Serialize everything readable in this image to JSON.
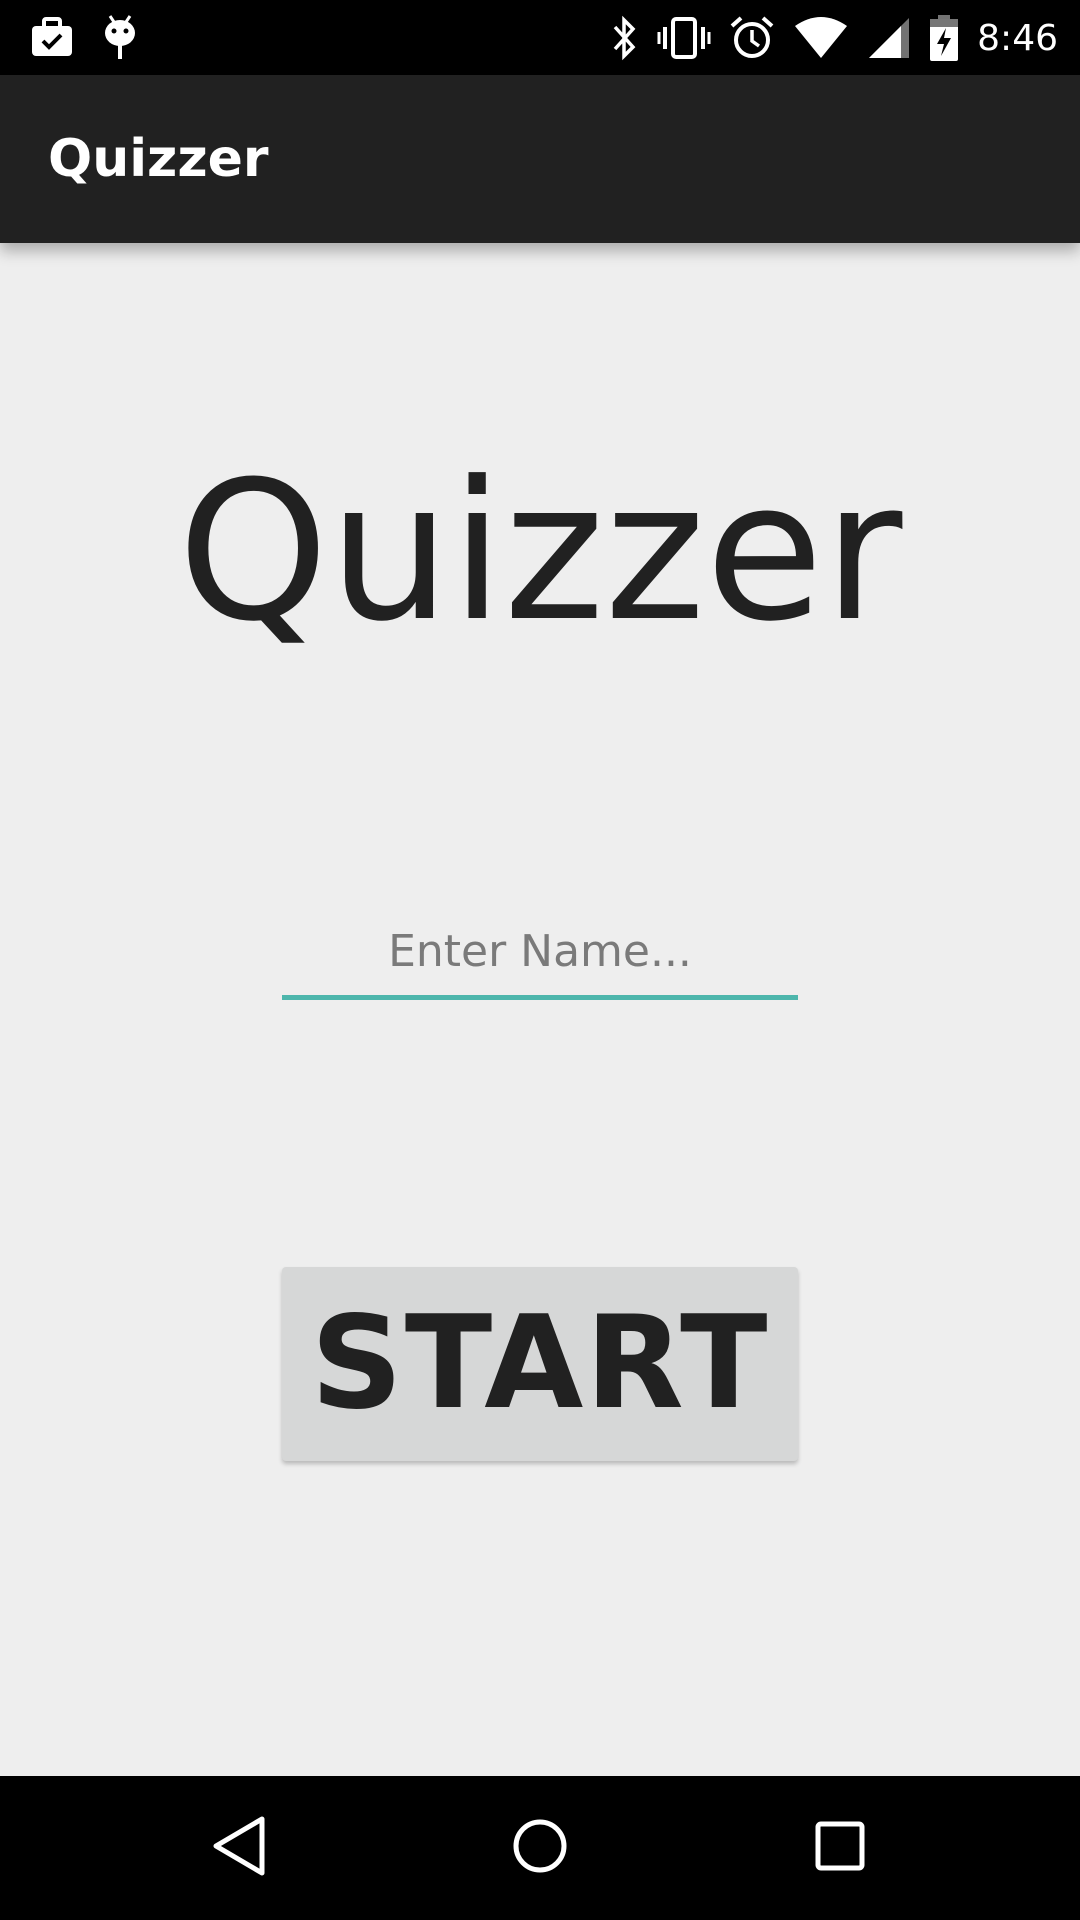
{
  "status_bar": {
    "time": "8:46",
    "left_icons": [
      "briefcase-check-icon",
      "android-debug-icon"
    ],
    "right_icons": [
      "bluetooth-icon",
      "vibrate-icon",
      "alarm-icon",
      "wifi-icon",
      "cell-signal-icon",
      "battery-charging-icon"
    ]
  },
  "app_bar": {
    "title": "Quizzer"
  },
  "main": {
    "heading": "Quizzer",
    "name_input": {
      "value": "",
      "placeholder": "Enter Name..."
    },
    "start_button_label": "START"
  },
  "nav_bar": {
    "icons": [
      "back-icon",
      "home-icon",
      "recents-icon"
    ]
  },
  "colors": {
    "app_bar": "#212121",
    "background": "#eeeeee",
    "accent_underline": "#4db6ac",
    "button": "#d6d7d7",
    "text": "#212121"
  }
}
